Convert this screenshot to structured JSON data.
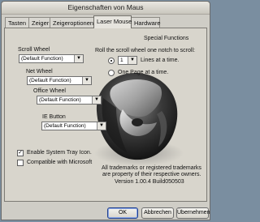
{
  "window": {
    "title": "Eigenschaften von Maus"
  },
  "tabs": [
    "Tasten",
    "Zeiger",
    "Zeigeroptionen",
    "Laser Mouse",
    "Hardware"
  ],
  "special": {
    "label": "Special Functions",
    "scroll_label": "Scroll Wheel",
    "scroll_value": "(Default Function)",
    "net_label": "Net Wheel",
    "net_value": "(Default Function)",
    "office_label": "Office Wheel",
    "office_value": "(Default Function)",
    "ie_label": "IE Button",
    "ie_value": "(Default Function)",
    "roll_text": "Roll the scroll wheel one notch to scroll:",
    "lines_value": "1",
    "lines_label": "Lines at a time.",
    "page_label": "One Page at a time.",
    "tray_label": "Enable System Tray Icon.",
    "compat_label": "Compatible with Microsoft",
    "trademark1": "All trademarks or registered trademarks",
    "trademark2": "are property of their respective owners.",
    "version": "Version 1.00.4 Build050503"
  },
  "buttons": {
    "ok": "OK",
    "cancel": "Abbrechen",
    "apply": "Übernehmen"
  },
  "state": {
    "tray_checked": true,
    "compat_checked": false,
    "lines_selected": true
  },
  "colors": {
    "accent": "#1f3e8c",
    "desktop": "#7a8ea0"
  }
}
